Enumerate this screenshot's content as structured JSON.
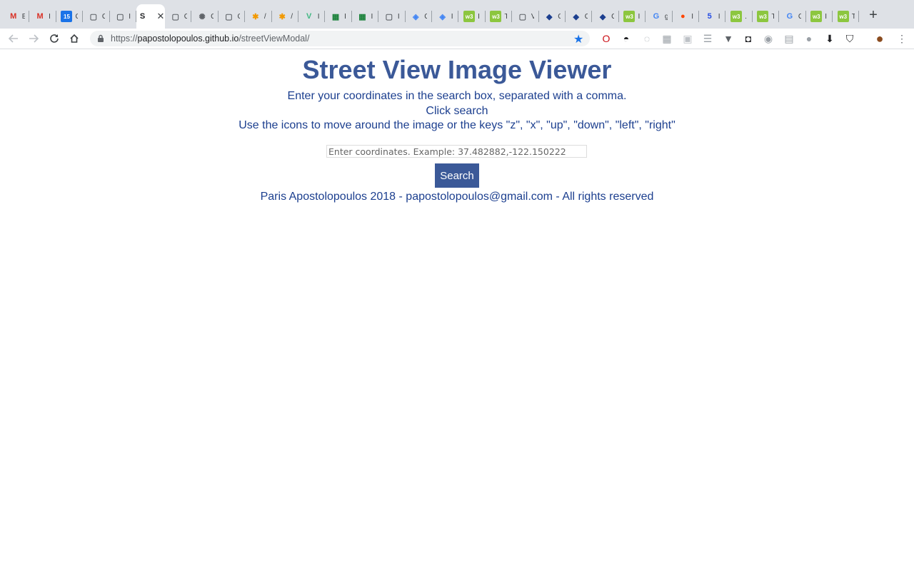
{
  "browser": {
    "tabs": [
      {
        "icon": "gmail-icon",
        "glyph": "M",
        "color": "#d93025",
        "text": "E"
      },
      {
        "icon": "gmail-icon",
        "glyph": "M",
        "color": "#d93025",
        "text": "I"
      },
      {
        "icon": "calendar-icon",
        "glyph": "15",
        "color": "#1a73e8",
        "text": "C"
      },
      {
        "icon": "document-icon",
        "glyph": "▢",
        "color": "#5f6368",
        "text": "C"
      },
      {
        "icon": "document-icon",
        "glyph": "▢",
        "color": "#5f6368",
        "text": "I"
      },
      {
        "icon": "site-icon",
        "glyph": "S",
        "color": "#202124",
        "text": "",
        "active": true
      },
      {
        "icon": "document-icon",
        "glyph": "▢",
        "color": "#5f6368",
        "text": "C"
      },
      {
        "icon": "openai-icon",
        "glyph": "✺",
        "color": "#5f6368",
        "text": "C"
      },
      {
        "icon": "document-icon",
        "glyph": "▢",
        "color": "#5f6368",
        "text": "C"
      },
      {
        "icon": "asterisk-icon",
        "glyph": "✱",
        "color": "#f29900",
        "text": "/"
      },
      {
        "icon": "asterisk-icon",
        "glyph": "✱",
        "color": "#f29900",
        "text": "/"
      },
      {
        "icon": "vue-icon",
        "glyph": "V",
        "color": "#41b883",
        "text": "I"
      },
      {
        "icon": "sheets-icon",
        "glyph": "▦",
        "color": "#188038",
        "text": "I"
      },
      {
        "icon": "sheets-icon",
        "glyph": "▦",
        "color": "#188038",
        "text": "I"
      },
      {
        "icon": "document-icon",
        "glyph": "▢",
        "color": "#5f6368",
        "text": "I"
      },
      {
        "icon": "shield-icon",
        "glyph": "◈",
        "color": "#4285f4",
        "text": "C"
      },
      {
        "icon": "shield-icon",
        "glyph": "◈",
        "color": "#4285f4",
        "text": "I"
      },
      {
        "icon": "w3-icon",
        "glyph": "w3",
        "color": "#8cc63f",
        "text": "I"
      },
      {
        "icon": "w3-icon",
        "glyph": "w3",
        "color": "#8cc63f",
        "text": "T"
      },
      {
        "icon": "document-icon",
        "glyph": "▢",
        "color": "#5f6368",
        "text": "V"
      },
      {
        "icon": "bird-icon",
        "glyph": "◆",
        "color": "#1c3f8f",
        "text": "C"
      },
      {
        "icon": "bird-icon",
        "glyph": "◆",
        "color": "#1c3f8f",
        "text": "C"
      },
      {
        "icon": "bird-icon",
        "glyph": "◆",
        "color": "#1c3f8f",
        "text": "C"
      },
      {
        "icon": "w3-icon",
        "glyph": "w3",
        "color": "#8cc63f",
        "text": "I"
      },
      {
        "icon": "google-icon",
        "glyph": "G",
        "color": "#4285f4",
        "text": "g"
      },
      {
        "icon": "reddit-icon",
        "glyph": "●",
        "color": "#ff4500",
        "text": "I"
      },
      {
        "icon": "html5-icon",
        "glyph": "5",
        "color": "#264de4",
        "text": "I"
      },
      {
        "icon": "w3-icon",
        "glyph": "w3",
        "color": "#8cc63f",
        "text": "."
      },
      {
        "icon": "w3-icon",
        "glyph": "w3",
        "color": "#8cc63f",
        "text": "T"
      },
      {
        "icon": "google-icon",
        "glyph": "G",
        "color": "#4285f4",
        "text": "C"
      },
      {
        "icon": "w3-icon",
        "glyph": "w3",
        "color": "#8cc63f",
        "text": "I"
      },
      {
        "icon": "w3-icon",
        "glyph": "w3",
        "color": "#8cc63f",
        "text": "T"
      }
    ],
    "active_tab_title": "S",
    "url_prefix": "https://",
    "url_host": "papostolopoulos.github.io",
    "url_path": "/streetViewModal/",
    "extensions": [
      "opera-icon",
      "incognito-icon",
      "puzzle-icon",
      "grid-icon",
      "box-icon",
      "list-icon",
      "vimeo-icon",
      "pocket-icon",
      "cat-icon",
      "print-icon",
      "circle-icon",
      "download-icon",
      "shield-icon",
      "avatar"
    ]
  },
  "page": {
    "title": "Street View Image Viewer",
    "instructions": [
      "Enter your coordinates in the search box, separated with a comma.",
      "Click search",
      "Use the icons to move around the image or the keys \"z\", \"x\", \"up\", \"down\", \"left\", \"right\""
    ],
    "search": {
      "placeholder": "Enter coordinates. Example: 37.482882,-122.150222",
      "value": ""
    },
    "search_button": "Search",
    "footer": "Paris Apostolopoulos 2018 - papostolopoulos@gmail.com - All rights reserved"
  },
  "colors": {
    "title": "#3b5998",
    "text": "#1c3f8f",
    "button": "#3b5998"
  }
}
